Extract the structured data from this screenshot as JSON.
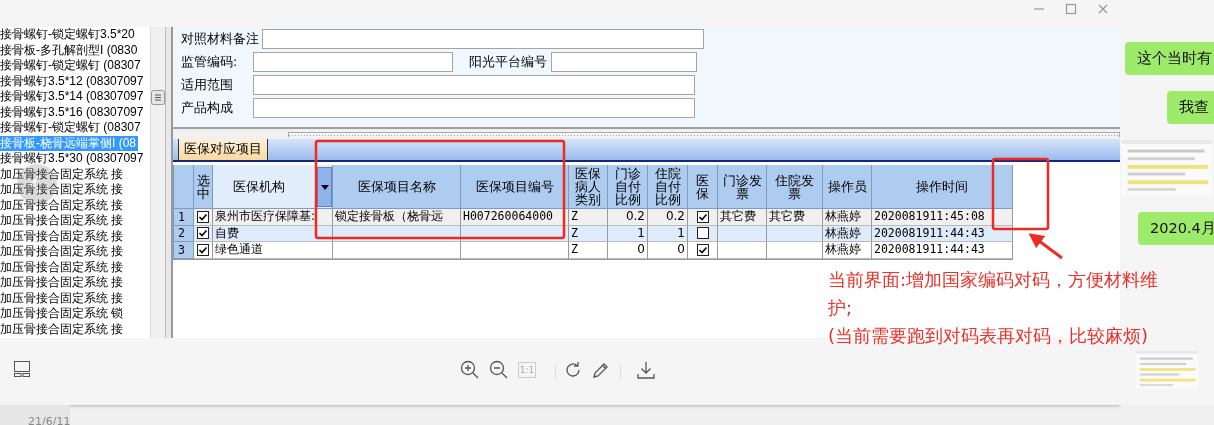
{
  "screenshot": {
    "material_list": {
      "items": [
        {
          "label": "接骨螺钉-锁定螺钉3.5*20",
          "selected": false
        },
        {
          "label": "接骨板-多孔解剖型I (0830",
          "selected": false
        },
        {
          "label": "接骨螺钉-锁定螺钉 (08307",
          "selected": false
        },
        {
          "label": "接骨螺钉3.5*12 (08307097",
          "selected": false
        },
        {
          "label": "接骨螺钉3.5*14 (08307097",
          "selected": false
        },
        {
          "label": "接骨螺钉3.5*16 (08307097",
          "selected": false
        },
        {
          "label": "接骨螺钉-锁定螺钉 (08307",
          "selected": false
        },
        {
          "label": "接骨板-桡骨远端掌侧I (08",
          "selected": true
        },
        {
          "label": "接骨螺钉3.5*30 (08307097",
          "selected": false
        },
        {
          "label": "加压骨接合固定系统 接",
          "selected": false
        },
        {
          "label": "加压骨接合固定系统 接",
          "selected": false
        },
        {
          "label": "加压骨接合固定系统 接",
          "selected": false
        },
        {
          "label": "加压骨接合固定系统 接",
          "selected": false
        },
        {
          "label": "加压骨接合固定系统 接",
          "selected": false
        },
        {
          "label": "加压骨接合固定系统 接",
          "selected": false
        },
        {
          "label": "加压骨接合固定系统 接",
          "selected": false
        },
        {
          "label": "加压骨接合固定系统 接",
          "selected": false
        },
        {
          "label": "加压骨接合固定系统 接",
          "selected": false
        },
        {
          "label": "加压骨接合固定系统 锁",
          "selected": false
        },
        {
          "label": "加压骨接合固定系统 接",
          "selected": false
        }
      ]
    },
    "form": {
      "rows": [
        [
          {
            "label": "对照材料备注"
          }
        ],
        [
          {
            "label": "监管编码:"
          },
          {
            "label": "阳光平台编号"
          }
        ],
        [
          {
            "label": "适用范围"
          }
        ],
        [
          {
            "label": "产品构成"
          }
        ]
      ]
    },
    "tabs": [
      {
        "label": "医保对应项目",
        "selected": true
      }
    ],
    "table": {
      "columns": [
        {
          "label": "选中",
          "kind": "check"
        },
        {
          "label": "医保机构",
          "kind": "text",
          "dropdown": true
        },
        {
          "label": "医保项目名称",
          "kind": "text"
        },
        {
          "label": "医保项目编号",
          "kind": "mono"
        },
        {
          "label": "医保病人类别",
          "kind": "mono"
        },
        {
          "label": "门诊自付比例",
          "kind": "number"
        },
        {
          "label": "住院自付比例",
          "kind": "number"
        },
        {
          "label": "医保",
          "kind": "check"
        },
        {
          "label": "门诊发票",
          "kind": "text"
        },
        {
          "label": "住院发票",
          "kind": "text"
        },
        {
          "label": "操作员",
          "kind": "text"
        },
        {
          "label": "操作时间",
          "kind": "mono"
        }
      ],
      "rows": [
        {
          "number": "1",
          "selected": true,
          "cells": [
            true,
            "泉州市医疗保障基:",
            "锁定接骨板（桡骨远",
            "H007260064000",
            "Z",
            "0.2",
            "0.2",
            true,
            "其它费",
            "其它费",
            "林燕婷",
            "2020081911:45:08"
          ]
        },
        {
          "number": "2",
          "selected": false,
          "cells": [
            true,
            "自费",
            null,
            null,
            "Z",
            "1",
            "1",
            false,
            null,
            null,
            "林燕婷",
            "2020081911:44:43"
          ]
        },
        {
          "number": "3",
          "selected": false,
          "cells": [
            true,
            "绿色通道",
            null,
            null,
            "Z",
            "0",
            "0",
            true,
            null,
            null,
            "林燕婷",
            "2020081911:44:43"
          ]
        }
      ]
    }
  },
  "annotation": {
    "notes": [
      "当前界面:增加国家编码对码，方便材料维护;",
      "(当前需要跑到对码表再对码，比较麻烦)"
    ]
  },
  "toolbar": {
    "actual_size": {
      "label": "1:1",
      "disabled": true
    }
  },
  "chat": {
    "items": [
      {
        "kind": "bubble",
        "text": "这个当时有"
      },
      {
        "kind": "bubble",
        "text": "我查"
      },
      {
        "kind": "picture"
      },
      {
        "kind": "bubble",
        "text": "2020.4月"
      },
      {
        "kind": "picture"
      }
    ]
  },
  "date_stamp": "21/6/11"
}
